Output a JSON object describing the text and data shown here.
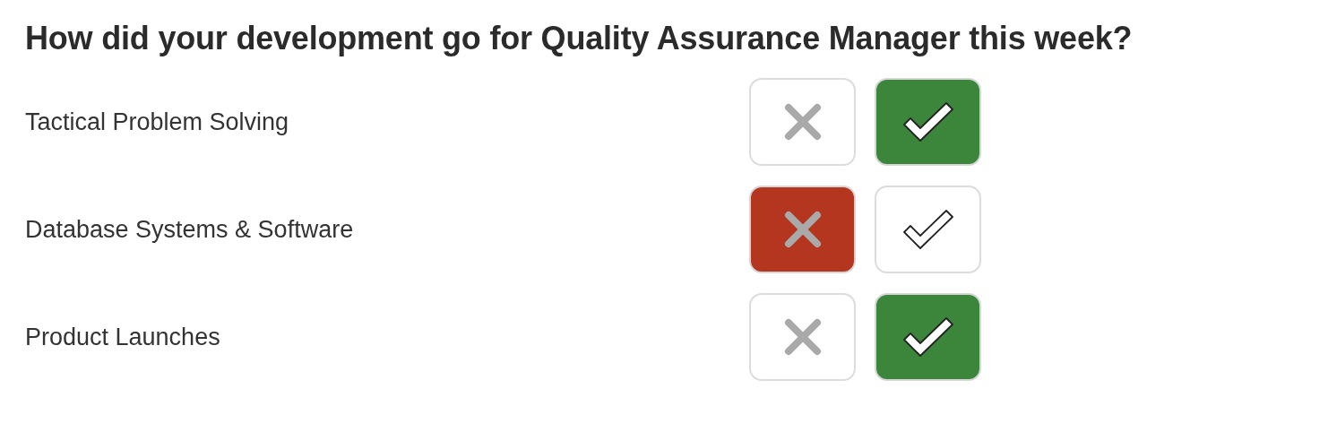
{
  "question": "How did your development go for Quality Assurance Manager this week?",
  "skills": [
    {
      "label": "Tactical Problem Solving",
      "choices": [
        {
          "kind": "no",
          "selected": false
        },
        {
          "kind": "yes",
          "selected": true
        }
      ]
    },
    {
      "label": "Database Systems & Software",
      "choices": [
        {
          "kind": "no",
          "selected": true
        },
        {
          "kind": "yes",
          "selected": false
        }
      ]
    },
    {
      "label": "Product Launches",
      "choices": [
        {
          "kind": "no",
          "selected": false
        },
        {
          "kind": "yes",
          "selected": true
        }
      ]
    }
  ]
}
